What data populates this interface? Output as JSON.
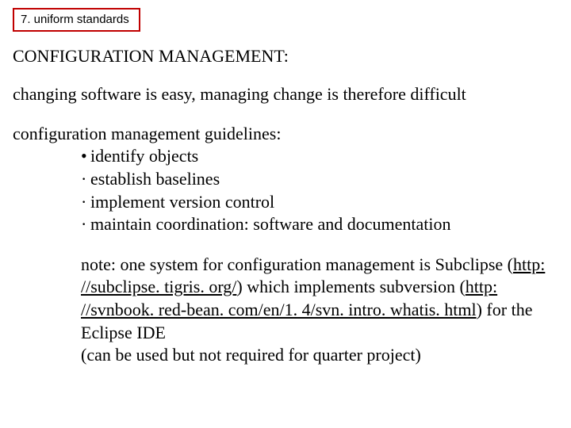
{
  "box_label": "7. uniform standards",
  "heading": "CONFIGURATION MANAGEMENT:",
  "intro_line": "changing software is easy, managing change is therefore difficult",
  "guidelines_intro": "configuration management guidelines:",
  "bullets": {
    "b0": "identify objects",
    "b1": "establish baselines",
    "b2": "implement version control",
    "b3": "maintain coordination:  software and documentation"
  },
  "note": {
    "pre1": "note: one system for configuration management is Subclipse (",
    "link1": "http: //subclipse. tigris. org/",
    "mid": ") which implements subversion (",
    "link2": "http: //svnbook. red-bean. com/en/1. 4/svn. intro. whatis. html",
    "post": ") for the Eclipse IDE",
    "line4": "(can be used but not required for quarter project)"
  }
}
